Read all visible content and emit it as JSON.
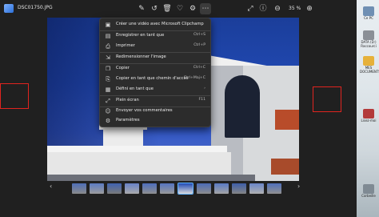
{
  "window": {
    "filename": "DSC01750.JPG",
    "zoom": "35 %"
  },
  "toolbar": {
    "icons": [
      "edit-icon",
      "rotate-icon",
      "delete-icon",
      "favorite-icon",
      "photo-adjust-icon",
      "more-icon"
    ],
    "right_icons": [
      "fullscreen-icon",
      "info-icon",
      "zoom-out-icon",
      "zoom-in-icon"
    ]
  },
  "context_menu": {
    "items": [
      {
        "label": "Créer une vidéo avec Microsoft Clipchamp",
        "shortcut": "",
        "icon": "clipchamp-icon"
      },
      {
        "label": "Enregistrer en tant que",
        "shortcut": "Ctrl+S",
        "icon": "save-icon"
      },
      {
        "label": "Imprimer",
        "shortcut": "Ctrl+P",
        "icon": "print-icon"
      },
      {
        "label": "Redimensionner l'image",
        "shortcut": "",
        "icon": "resize-icon"
      },
      {
        "label": "Copier",
        "shortcut": "Ctrl+C",
        "icon": "copy-icon"
      },
      {
        "label": "Copier en tant que chemin d'accès",
        "shortcut": "Ctrl+Maj+C",
        "icon": "copy-path-icon"
      },
      {
        "label": "Défini en tant que",
        "shortcut": "›",
        "icon": "set-as-icon"
      },
      {
        "label": "Plein écran",
        "shortcut": "F11",
        "icon": "fullscreen-icon"
      },
      {
        "label": "Envoyer vos commentaires",
        "shortcut": "",
        "icon": "feedback-icon"
      },
      {
        "label": "Paramètres",
        "shortcut": "",
        "icon": "settings-icon"
      }
    ]
  },
  "desktop": {
    "icons": [
      {
        "label": "Ce PC",
        "color": "#6f8fb3"
      },
      {
        "label": "DATA (D:) Raccourci",
        "color": "#8a8f96"
      },
      {
        "label": "MES DOCUMENTS",
        "color": "#e6b13a"
      },
      {
        "label": "Lisez-moi",
        "color": "#b33a3a"
      },
      {
        "label": "Corbeille",
        "color": "#7f8a93"
      }
    ]
  },
  "colors": {
    "accent": "#5fb2ff",
    "highlight_box": "#e0241f",
    "menu_bg": "#2c2c2c"
  }
}
